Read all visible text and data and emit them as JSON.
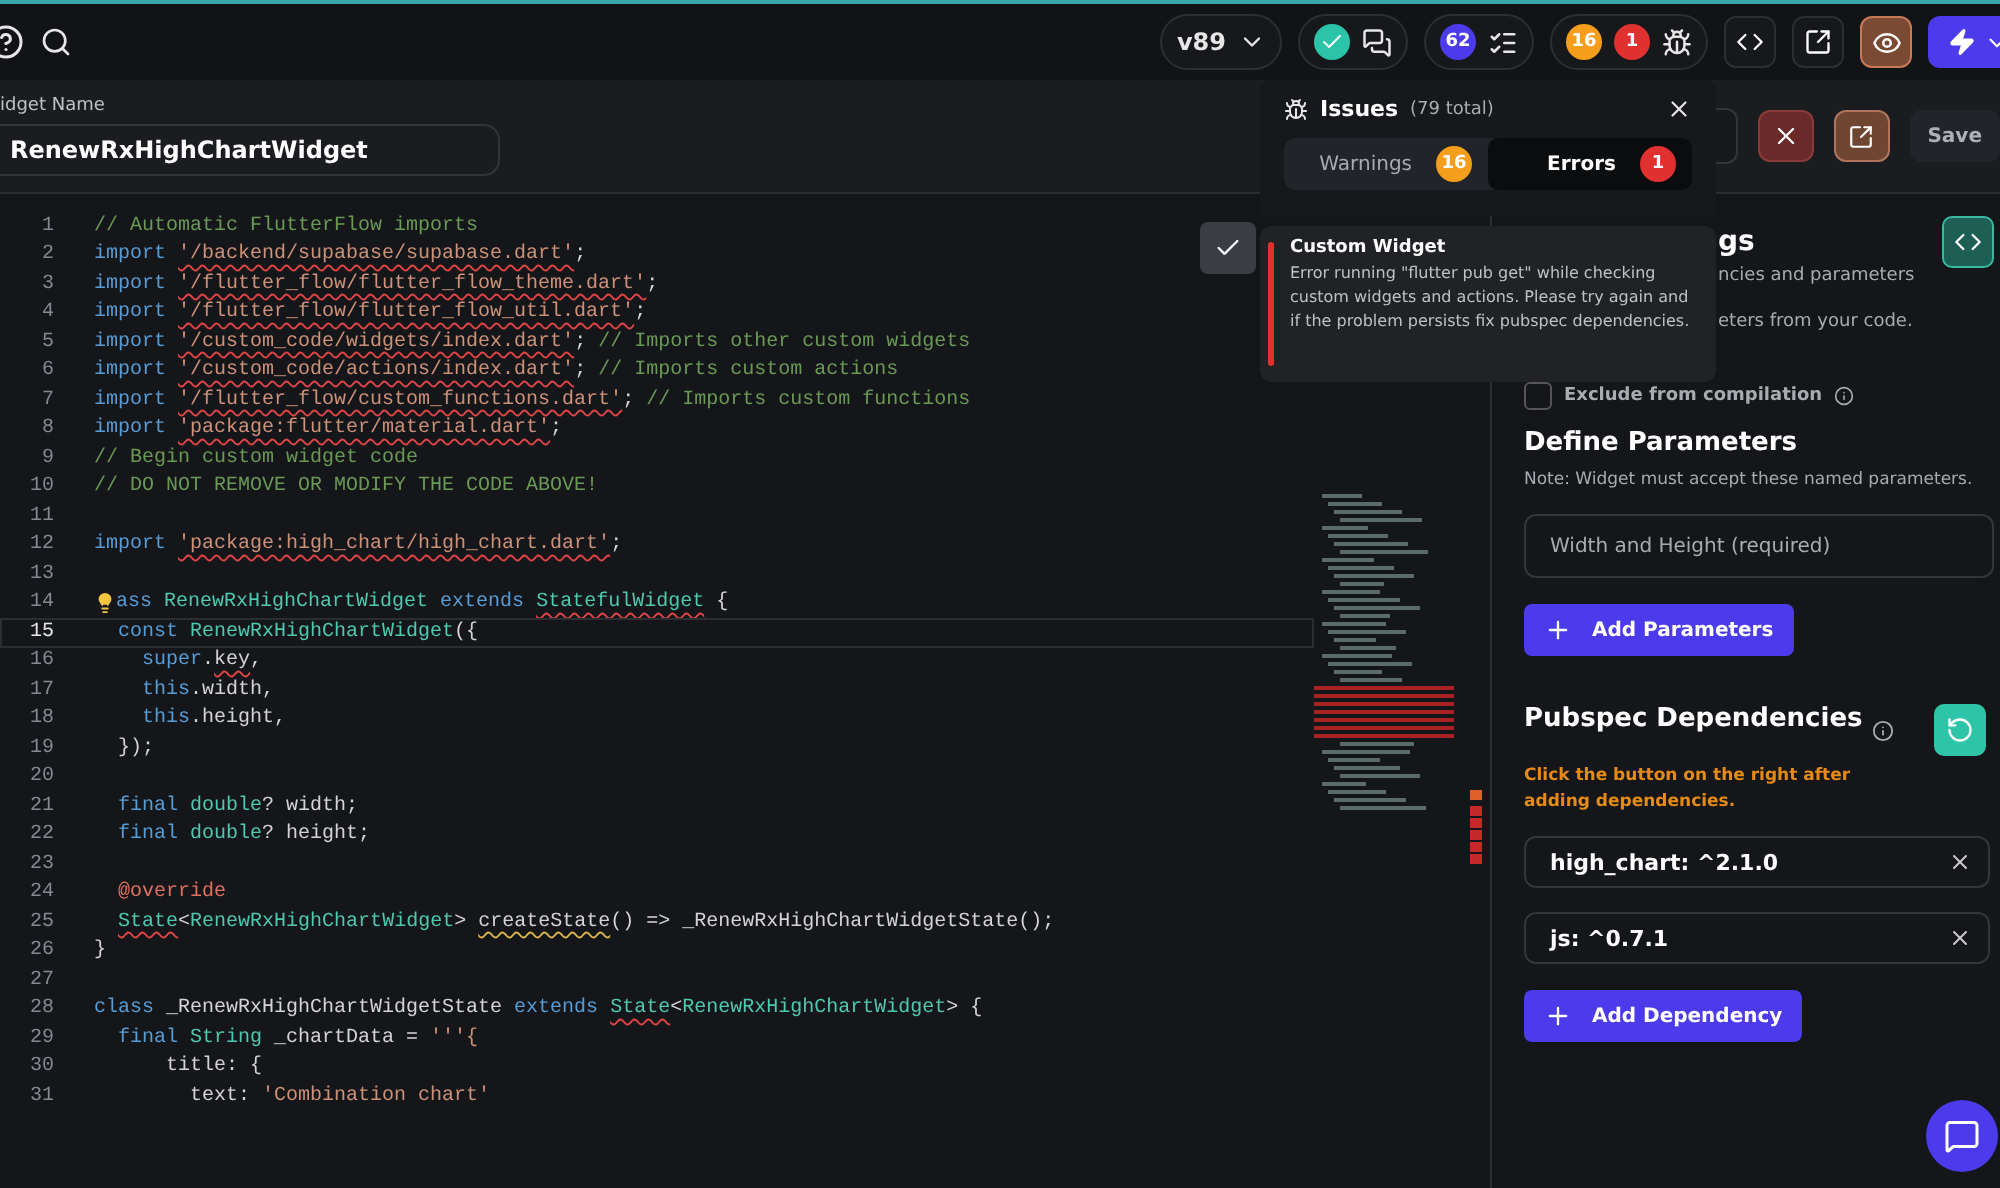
{
  "top_bar": {
    "version": "v89",
    "checks_count": {
      "text": "62",
      "color": "#4b3bea"
    },
    "issue_counts": [
      {
        "text": "16",
        "color": "#f59e1b"
      },
      {
        "text": "1",
        "color": "#e03131"
      }
    ],
    "preview_selected": true
  },
  "widget_name": {
    "label": "idget Name",
    "value": "RenewRxHighChartWidget"
  },
  "header_actions": {
    "save": "Save"
  },
  "editor": {
    "lines": [
      {
        "number": "1",
        "current": false,
        "tokens": [
          {
            "text": "// Automatic FlutterFlow imports",
            "kind": "comment"
          }
        ]
      },
      {
        "number": "2",
        "current": false,
        "tokens": [
          {
            "text": "import ",
            "kind": "keyword"
          },
          {
            "text": "'/backend/supabase/supabase.dart'",
            "kind": "string",
            "error": true
          },
          {
            "text": ";",
            "kind": "plain"
          }
        ]
      },
      {
        "number": "3",
        "current": false,
        "tokens": [
          {
            "text": "import ",
            "kind": "keyword"
          },
          {
            "text": "'/flutter_flow/flutter_flow_theme.dart'",
            "kind": "string",
            "error": true
          },
          {
            "text": ";",
            "kind": "plain"
          }
        ]
      },
      {
        "number": "4",
        "current": false,
        "tokens": [
          {
            "text": "import ",
            "kind": "keyword"
          },
          {
            "text": "'/flutter_flow/flutter_flow_util.dart'",
            "kind": "string",
            "error": true
          },
          {
            "text": ";",
            "kind": "plain"
          }
        ]
      },
      {
        "number": "5",
        "current": false,
        "tokens": [
          {
            "text": "import ",
            "kind": "keyword"
          },
          {
            "text": "'/custom_code/widgets/index.dart'",
            "kind": "string",
            "error": true
          },
          {
            "text": "; ",
            "kind": "plain"
          },
          {
            "text": "// Imports other custom widgets",
            "kind": "comment"
          }
        ]
      },
      {
        "number": "6",
        "current": false,
        "tokens": [
          {
            "text": "import ",
            "kind": "keyword"
          },
          {
            "text": "'/custom_code/actions/index.dart'",
            "kind": "string",
            "error": true
          },
          {
            "text": "; ",
            "kind": "plain"
          },
          {
            "text": "// Imports custom actions",
            "kind": "comment"
          }
        ]
      },
      {
        "number": "7",
        "current": false,
        "tokens": [
          {
            "text": "import ",
            "kind": "keyword"
          },
          {
            "text": "'/flutter_flow/custom_functions.dart'",
            "kind": "string",
            "error": true
          },
          {
            "text": "; ",
            "kind": "plain"
          },
          {
            "text": "// Imports custom functions",
            "kind": "comment"
          }
        ]
      },
      {
        "number": "8",
        "current": false,
        "tokens": [
          {
            "text": "import ",
            "kind": "keyword"
          },
          {
            "text": "'package:flutter/material.dart'",
            "kind": "string",
            "error": true
          },
          {
            "text": ";",
            "kind": "plain"
          }
        ]
      },
      {
        "number": "9",
        "current": false,
        "tokens": [
          {
            "text": "// Begin custom widget code",
            "kind": "comment"
          }
        ]
      },
      {
        "number": "10",
        "current": false,
        "tokens": [
          {
            "text": "// DO NOT REMOVE OR MODIFY THE CODE ABOVE!",
            "kind": "comment"
          }
        ]
      },
      {
        "number": "11",
        "current": false
      },
      {
        "number": "12",
        "current": false,
        "tokens": [
          {
            "text": "import ",
            "kind": "keyword"
          },
          {
            "text": "'package:high_chart/high_chart.dart'",
            "kind": "string",
            "error": true
          },
          {
            "text": ";",
            "kind": "plain"
          }
        ]
      },
      {
        "number": "13",
        "current": false
      },
      {
        "number": "14",
        "current": false,
        "bulb": true,
        "tokens": [
          {
            "text": "ass ",
            "kind": "keyword"
          },
          {
            "text": "RenewRxHighChartWidget",
            "kind": "type"
          },
          {
            "text": " extends ",
            "kind": "keyword"
          },
          {
            "text": "StatefulWidget",
            "kind": "type",
            "error": true
          },
          {
            "text": " {",
            "kind": "plain"
          }
        ]
      },
      {
        "number": "15",
        "current": true,
        "tokens": [
          {
            "text": "  const ",
            "kind": "keyword"
          },
          {
            "text": "RenewRxHighChartWidget",
            "kind": "type"
          },
          {
            "text": "({",
            "kind": "plain"
          }
        ]
      },
      {
        "number": "16",
        "current": false,
        "tokens": [
          {
            "text": "    super",
            "kind": "keyword"
          },
          {
            "text": ".",
            "kind": "plain"
          },
          {
            "text": "key",
            "kind": "plain",
            "error": true
          },
          {
            "text": ",",
            "kind": "plain"
          }
        ]
      },
      {
        "number": "17",
        "current": false,
        "tokens": [
          {
            "text": "    this",
            "kind": "keyword"
          },
          {
            "text": ".width,",
            "kind": "plain"
          }
        ]
      },
      {
        "number": "18",
        "current": false,
        "tokens": [
          {
            "text": "    this",
            "kind": "keyword"
          },
          {
            "text": ".height,",
            "kind": "plain"
          }
        ]
      },
      {
        "number": "19",
        "current": false,
        "tokens": [
          {
            "text": "  });",
            "kind": "plain"
          }
        ]
      },
      {
        "number": "20",
        "current": false
      },
      {
        "number": "21",
        "current": false,
        "tokens": [
          {
            "text": "  final ",
            "kind": "keyword"
          },
          {
            "text": "double",
            "kind": "type"
          },
          {
            "text": "? width;",
            "kind": "plain"
          }
        ]
      },
      {
        "number": "22",
        "current": false,
        "tokens": [
          {
            "text": "  final ",
            "kind": "keyword"
          },
          {
            "text": "double",
            "kind": "type"
          },
          {
            "text": "? height;",
            "kind": "plain"
          }
        ]
      },
      {
        "number": "23",
        "current": false
      },
      {
        "number": "24",
        "current": false,
        "tokens": [
          {
            "text": "  @override",
            "kind": "annotation"
          }
        ]
      },
      {
        "number": "25",
        "current": false,
        "tokens": [
          {
            "text": "  State",
            "kind": "type",
            "error": true
          },
          {
            "text": "<",
            "kind": "plain"
          },
          {
            "text": "RenewRxHighChartWidget",
            "kind": "type"
          },
          {
            "text": "> ",
            "kind": "plain"
          },
          {
            "text": "createState",
            "kind": "plain",
            "warning": true
          },
          {
            "text": "() => _RenewRxHighChartWidgetState();",
            "kind": "plain"
          }
        ]
      },
      {
        "number": "26",
        "current": false,
        "tokens": [
          {
            "text": "}",
            "kind": "plain"
          }
        ]
      },
      {
        "number": "27",
        "current": false
      },
      {
        "number": "28",
        "current": false,
        "tokens": [
          {
            "text": "class",
            "kind": "keyword"
          },
          {
            "text": " _RenewRxHighChartWidgetState ",
            "kind": "plain"
          },
          {
            "text": "extends ",
            "kind": "keyword"
          },
          {
            "text": "State",
            "kind": "type",
            "error": true
          },
          {
            "text": "<",
            "kind": "plain"
          },
          {
            "text": "RenewRxHighChartWidget",
            "kind": "type"
          },
          {
            "text": "> {",
            "kind": "plain"
          }
        ]
      },
      {
        "number": "29",
        "current": false,
        "tokens": [
          {
            "text": "  final ",
            "kind": "keyword"
          },
          {
            "text": "String",
            "kind": "type"
          },
          {
            "text": " _chartData = ",
            "kind": "plain"
          },
          {
            "text": "'''{",
            "kind": "string"
          }
        ]
      },
      {
        "number": "30",
        "current": false,
        "tokens": [
          {
            "text": "      title: {",
            "kind": "plain"
          }
        ]
      },
      {
        "number": "31",
        "current": false,
        "tokens": [
          {
            "text": "        text: ",
            "kind": "plain"
          },
          {
            "text": "'Combination chart'",
            "kind": "string"
          }
        ]
      }
    ]
  },
  "issues_popup": {
    "title": "Issues",
    "total": "(79 total)",
    "tabs": [
      {
        "label": "Warnings",
        "count": "16",
        "color": "#f59e1b",
        "selected": false
      },
      {
        "label": "Errors",
        "count": "1",
        "color": "#e03131",
        "selected": true
      }
    ]
  },
  "tooltip": {
    "title": "Custom Widget",
    "message": "Error running \"flutter pub get\" while checking custom widgets and actions. Please try again and if the problem persists fix pubspec dependencies."
  },
  "settings": {
    "heading_fragment": "gs",
    "description_fragments": [
      "ncies and parameters",
      "eters from your code."
    ],
    "exclude": {
      "label": "Exclude from compilation",
      "checked": false
    }
  },
  "parameters": {
    "title": "Define Parameters",
    "note": "Note: Widget must accept these named parameters.",
    "fields": [
      {
        "placeholder": "Width and Height (required)"
      }
    ],
    "add_button": "Add Parameters"
  },
  "dependencies": {
    "title": "Pubspec Dependencies",
    "hint": "Click the button on the right after adding dependencies.",
    "items": [
      {
        "value": "high_chart: ^2.1.0"
      },
      {
        "value": "js: ^0.7.1"
      }
    ],
    "add_button": "Add Dependency"
  }
}
